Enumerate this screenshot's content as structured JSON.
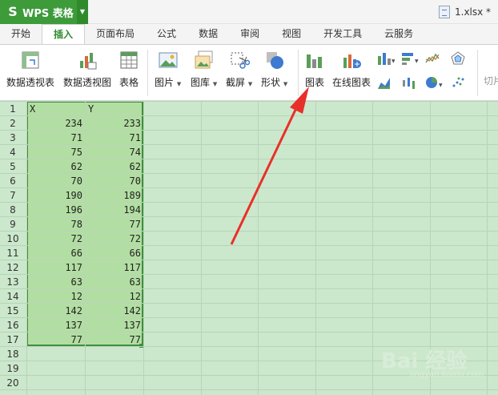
{
  "app": {
    "name": "WPS 表格",
    "logo": "S"
  },
  "file": {
    "name": "1.xlsx *"
  },
  "tabs": [
    "开始",
    "插入",
    "页面布局",
    "公式",
    "数据",
    "审阅",
    "视图",
    "开发工具",
    "云服务"
  ],
  "ribbon": {
    "pivot_table": "数据透视表",
    "pivot_chart": "数据透视图",
    "table": "表格",
    "picture": "图片",
    "gallery": "图库",
    "screenshot": "截屏",
    "shape": "形状",
    "chart": "图表",
    "online_chart": "在线图表",
    "slicer": "切片"
  },
  "grid": {
    "row_numbers": [
      "1",
      "2",
      "3",
      "4",
      "5",
      "6",
      "7",
      "8",
      "9",
      "10",
      "11",
      "12",
      "13",
      "14",
      "15",
      "16",
      "17",
      "18",
      "19",
      "20"
    ],
    "header": [
      "X",
      "Y"
    ],
    "rows": [
      [
        "234",
        "233"
      ],
      [
        "71",
        "71"
      ],
      [
        "75",
        "74"
      ],
      [
        "62",
        "62"
      ],
      [
        "70",
        "70"
      ],
      [
        "190",
        "189"
      ],
      [
        "196",
        "194"
      ],
      [
        "78",
        "77"
      ],
      [
        "72",
        "72"
      ],
      [
        "66",
        "66"
      ],
      [
        "117",
        "117"
      ],
      [
        "63",
        "63"
      ],
      [
        "12",
        "12"
      ],
      [
        "142",
        "142"
      ],
      [
        "137",
        "137"
      ],
      [
        "77",
        "77"
      ]
    ]
  },
  "watermark": {
    "text": "Bai 经验",
    "sub": "jingyan.baidu.com"
  },
  "colors": {
    "accent": "#3d9b3a",
    "grid_bg": "#cce8cc",
    "selection": "#b3dea3",
    "arrow": "#e8302a"
  }
}
